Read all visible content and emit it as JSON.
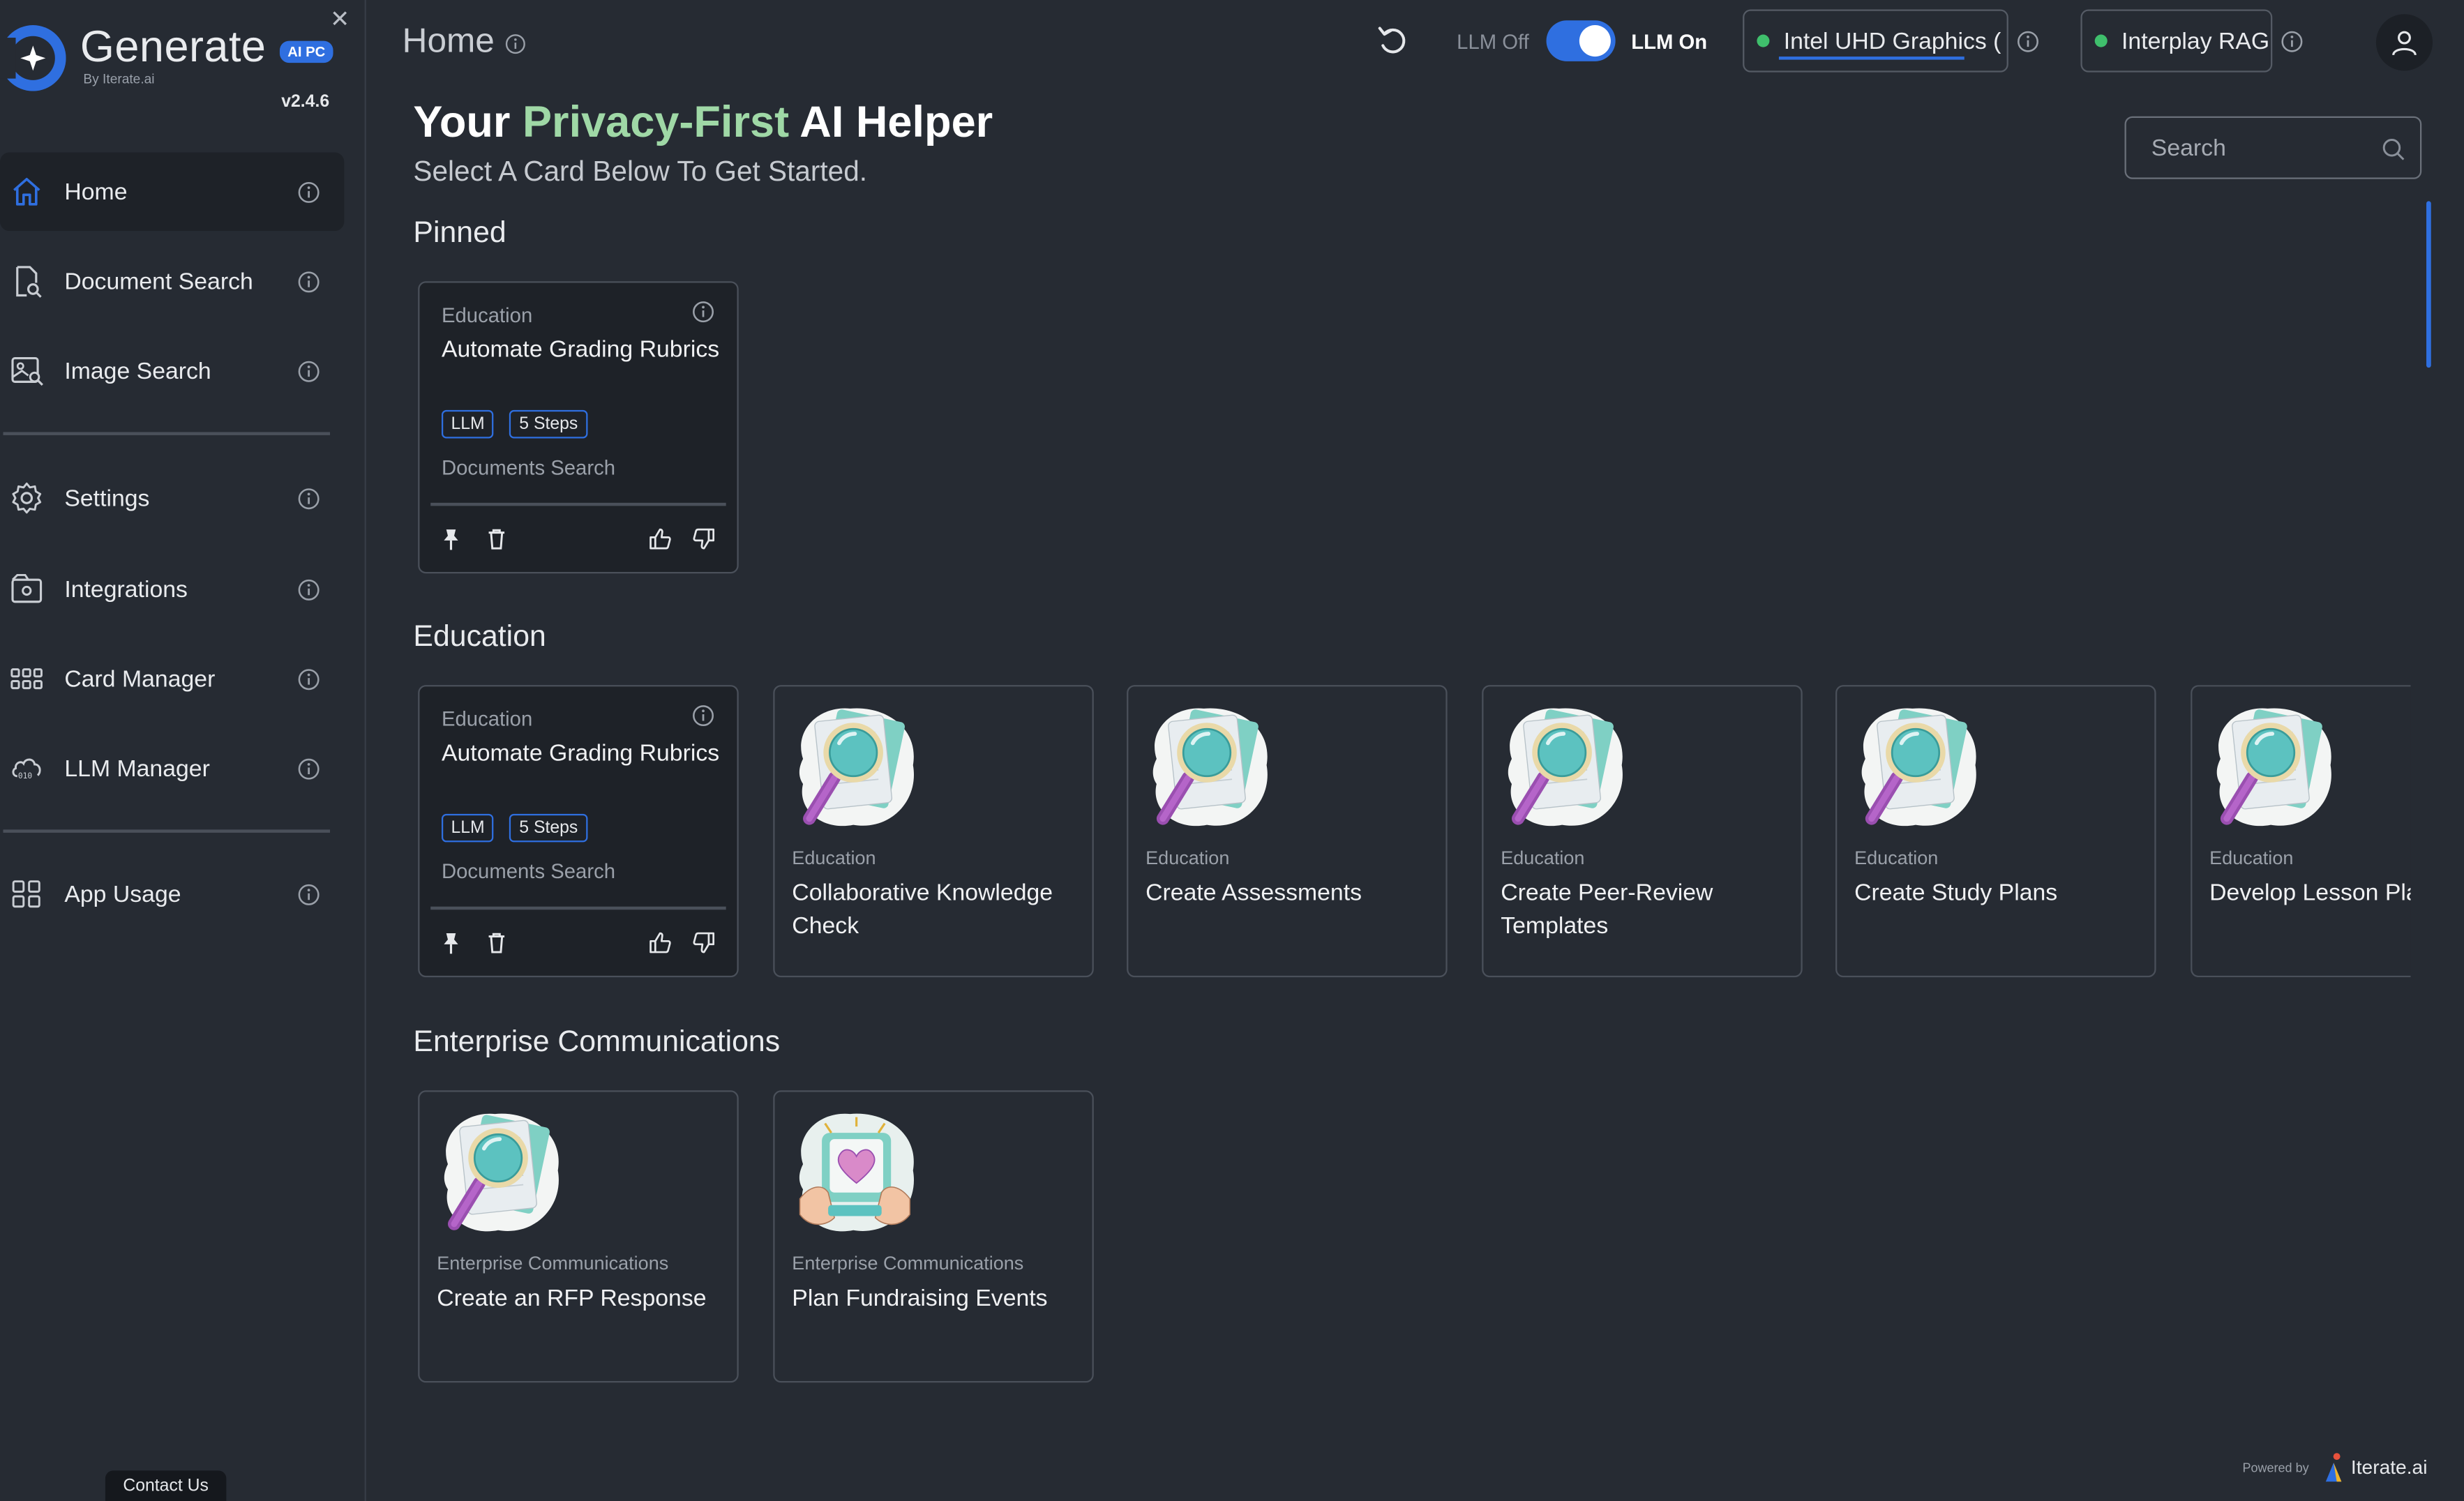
{
  "brand": {
    "name": "Generate",
    "badge": "AI PC",
    "by": "By Iterate.ai",
    "version": "v2.4.6"
  },
  "sidebar": {
    "items": [
      {
        "label": "Home"
      },
      {
        "label": "Document Search"
      },
      {
        "label": "Image Search"
      },
      {
        "label": "Settings"
      },
      {
        "label": "Integrations"
      },
      {
        "label": "Card Manager"
      },
      {
        "label": "LLM Manager"
      },
      {
        "label": "App Usage"
      }
    ],
    "contact": "Contact Us"
  },
  "header": {
    "title": "Home",
    "llm_off": "LLM Off",
    "llm_on": "LLM On",
    "llm_enabled": true,
    "device": "Intel UHD Graphics (",
    "rag": "Interplay RAG"
  },
  "hero": {
    "prefix": "Your",
    "accent": "Privacy-First",
    "suffix": "AI Helper",
    "subtitle": "Select A Card Below To Get Started."
  },
  "search": {
    "placeholder": "Search"
  },
  "sections": {
    "pinned": "Pinned",
    "education": "Education",
    "enterprise": "Enterprise Communications"
  },
  "pinned_card": {
    "category": "Education",
    "title": "Automate Grading Rubrics",
    "tags": [
      "LLM",
      "5 Steps"
    ],
    "subtitle": "Documents Search"
  },
  "education_cards": [
    {
      "category": "Education",
      "title": "Collaborative Knowledge Check"
    },
    {
      "category": "Education",
      "title": "Create Assessments"
    },
    {
      "category": "Education",
      "title": "Create Peer-Review Templates"
    },
    {
      "category": "Education",
      "title": "Create Study Plans"
    },
    {
      "category": "Education",
      "title": "Develop Lesson Pla"
    }
  ],
  "enterprise_cards": [
    {
      "category": "Enterprise Communications",
      "title": "Create an RFP Response"
    },
    {
      "category": "Enterprise Communications",
      "title": "Plan Fundraising Events"
    }
  ],
  "footer": {
    "powered_by": "Powered by",
    "company": "Iterate.ai"
  },
  "colors": {
    "accent": "#2f6fe0",
    "green": "#9fd8a6",
    "status": "#3fbf6c",
    "background": "#262b33"
  },
  "icons": [
    "close-icon",
    "home-icon",
    "document-search-icon",
    "image-search-icon",
    "gear-icon",
    "integrations-icon",
    "grid-icon",
    "llm-icon",
    "apps-icon",
    "info-icon",
    "refresh-icon",
    "user-icon",
    "search-icon",
    "pin-icon",
    "trash-icon",
    "thumbs-up-icon",
    "thumbs-down-icon"
  ]
}
